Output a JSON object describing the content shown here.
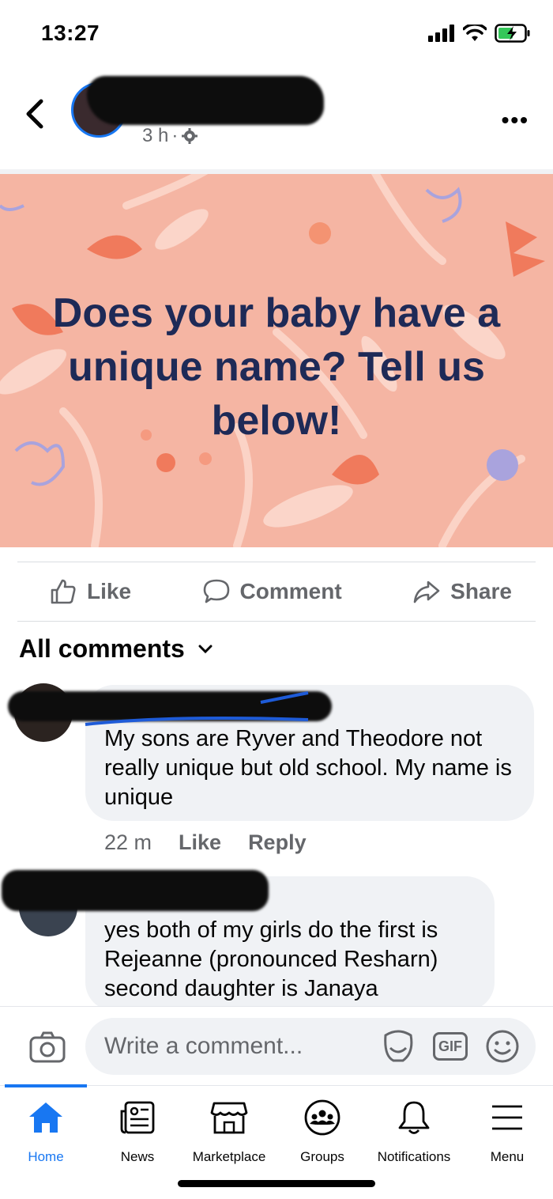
{
  "status_bar": {
    "time": "13:27"
  },
  "post": {
    "meta_time": "3 h",
    "banner_text": "Does your baby have a unique name? Tell us below!"
  },
  "actions": {
    "like": "Like",
    "comment": "Comment",
    "share": "Share"
  },
  "comments_header": {
    "label": "All comments"
  },
  "comments": [
    {
      "text": "My sons are Ryver and Theodore not really unique but old school. My name is unique",
      "time": "22 m",
      "like": "Like",
      "reply": "Reply"
    },
    {
      "text": "yes both of my girls do the first is Rejeanne (pronounced Resharn) second daughter is Janaya"
    }
  ],
  "composer": {
    "placeholder": "Write a comment...",
    "gif": "GIF"
  },
  "nav": {
    "active": "Home",
    "items": [
      {
        "label": "Home",
        "icon": "home-icon"
      },
      {
        "label": "News",
        "icon": "news-icon"
      },
      {
        "label": "Marketplace",
        "icon": "marketplace-icon"
      },
      {
        "label": "Groups",
        "icon": "groups-icon"
      },
      {
        "label": "Notifications",
        "icon": "bell-icon"
      },
      {
        "label": "Menu",
        "icon": "menu-icon"
      }
    ]
  },
  "colors": {
    "accent": "#1877f2",
    "banner_bg": "#f5b5a3",
    "banner_text": "#1e2a57"
  }
}
